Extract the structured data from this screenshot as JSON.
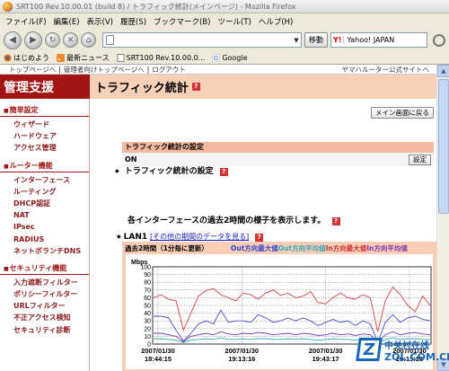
{
  "window": {
    "title": "SRT100 Rev.10.00.01 (build 8) / トラフィック統計(メインページ) - Mozilla Firefox"
  },
  "menu": {
    "items": [
      "ファイル(F)",
      "編集(E)",
      "表示(V)",
      "履歴(S)",
      "ブックマーク(B)",
      "ツール(T)",
      "ヘルプ(H)"
    ]
  },
  "toolbar": {
    "url": "",
    "go_label": "移動",
    "search_engine": "Y!",
    "search_value": "Yahoo! JAPAN"
  },
  "bookmarks": {
    "items": [
      "はじめよう",
      "最新ニュース",
      "SRT100 Rev.10.00.0...",
      "Google"
    ]
  },
  "page": {
    "topnav": {
      "links": [
        "トップページへ",
        "管理者向けトップページへ",
        "ログアウト"
      ],
      "right_link": "ヤマハルーター公式サイトへ"
    },
    "side_title": "管理支援",
    "page_title": "トラフィック統計",
    "help_glyph": "?",
    "return_button": "メイン画面に戻る",
    "sidebar": {
      "sections": [
        {
          "title": "簡単設定",
          "items": [
            "ウィザード",
            "ハードウェア",
            "アクセス管理"
          ]
        },
        {
          "title": "ルーター機能",
          "items": [
            "インターフェース",
            "ルーティング",
            "DHCP認証",
            "NAT",
            "IPsec",
            "RADIUS",
            "ネットボランチDNS"
          ]
        },
        {
          "title": "セキュリティ機能",
          "items": [
            "入力遮断フィルター",
            "ポリシーフィルター",
            "URLフィルター",
            "不正アクセス検知",
            "セキュリティ診断"
          ]
        }
      ]
    },
    "settings_section": {
      "title": "トラフィック統計の設定",
      "table_header": "トラフィック統計の設定",
      "value": "ON",
      "button": "設定"
    },
    "description": "各インターフェースの過去2時間の様子を表示します。",
    "lan": {
      "label": "LAN1",
      "link": "[その他の期間のデータを見る]",
      "graph_caption": "過去2時間（1分毎に更新）",
      "legend": {
        "out_max": "Out方向最大値",
        "out_avg": "Out方向平均値",
        "in_max": "In方向最大値",
        "in_avg": "In方向平均値"
      }
    }
  },
  "chart_data": {
    "type": "line",
    "ylabel": "Mbps",
    "ylim": [
      0,
      100
    ],
    "yticks": [
      0,
      10,
      20,
      30,
      40,
      50,
      60,
      70,
      80,
      90,
      100
    ],
    "xticks": [
      {
        "date": "2007/01/30",
        "time": "18:44:15"
      },
      {
        "date": "2007/01/30",
        "time": "19:13:16"
      },
      {
        "date": "2007/01/30",
        "time": "19:43:17"
      },
      {
        "date": "2007/01/30",
        "time": "20:13:18"
      }
    ],
    "grid": true,
    "colors": {
      "in_max": "#d84040",
      "out_max": "#4a4ad0",
      "in_avg": "#7a3aa8",
      "out_avg": "#2fa9b8"
    },
    "series": [
      {
        "name": "In方向最大値",
        "key": "in_max",
        "values": [
          60,
          64,
          58,
          56,
          18,
          40,
          62,
          69,
          72,
          64,
          60,
          56,
          66,
          64,
          58,
          66,
          70,
          63,
          66,
          60,
          62,
          68,
          54,
          52,
          60,
          66,
          60,
          58,
          64,
          60,
          16,
          56,
          74,
          64,
          50,
          42,
          62,
          50
        ]
      },
      {
        "name": "Out方向最大値",
        "key": "out_max",
        "values": [
          36,
          36,
          34,
          18,
          4,
          14,
          26,
          30,
          26,
          44,
          28,
          30,
          30,
          28,
          38,
          34,
          28,
          30,
          34,
          30,
          34,
          30,
          24,
          28,
          32,
          28,
          30,
          24,
          30,
          26,
          2,
          28,
          38,
          28,
          34,
          36,
          32,
          30
        ]
      },
      {
        "name": "In方向平均値",
        "key": "in_avg",
        "values": [
          14,
          14,
          12,
          10,
          3,
          10,
          12,
          14,
          12,
          16,
          13,
          12,
          14,
          13,
          15,
          14,
          12,
          13,
          14,
          12,
          14,
          13,
          11,
          12,
          14,
          12,
          13,
          11,
          13,
          12,
          2,
          12,
          16,
          12,
          14,
          15,
          13,
          12
        ]
      },
      {
        "name": "Out方向平均値",
        "key": "out_avg",
        "values": [
          7,
          7,
          6,
          5,
          2,
          5,
          6,
          7,
          6,
          8,
          6,
          6,
          7,
          6,
          7,
          7,
          6,
          6,
          7,
          6,
          7,
          6,
          5,
          6,
          7,
          6,
          6,
          5,
          6,
          6,
          1,
          6,
          8,
          6,
          7,
          7,
          6,
          6
        ]
      }
    ]
  },
  "watermark": {
    "logo_letter": "Z",
    "text_top": "中关村在线",
    "text_bottom": "ZOL.COM.CN"
  }
}
